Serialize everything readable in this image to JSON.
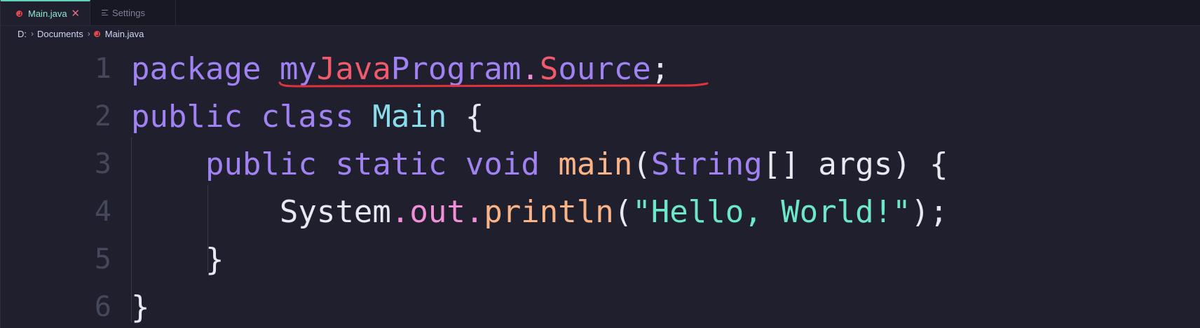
{
  "tabs": [
    {
      "label": "Main.java",
      "active": true,
      "icon": "java-icon",
      "close": "✕"
    },
    {
      "label": "Settings",
      "active": false,
      "icon": "settings-icon"
    }
  ],
  "breadcrumb": {
    "drive": "D:",
    "folder": "Documents",
    "file": "Main.java",
    "separator": "›"
  },
  "editor": {
    "lines": [
      {
        "number": "1",
        "text": "package myJavaProgram.Source;"
      },
      {
        "number": "2",
        "text": "public class Main {"
      },
      {
        "number": "3",
        "text": "    public static void main(String[] args) {"
      },
      {
        "number": "4",
        "text": "        System.out.println(\"Hello, World!\");"
      },
      {
        "number": "5",
        "text": "    }"
      },
      {
        "number": "6",
        "text": "}"
      }
    ],
    "error_underline": {
      "line": "1",
      "token": "myJavaProgram.Source",
      "color": "#e0323c"
    }
  },
  "colors": {
    "keyword": "#a182f2",
    "class": "#89dceb",
    "function": "#fab387",
    "string": "#6ee7c7",
    "accent_tab": "#5fd4b4",
    "error": "#e0323c"
  }
}
